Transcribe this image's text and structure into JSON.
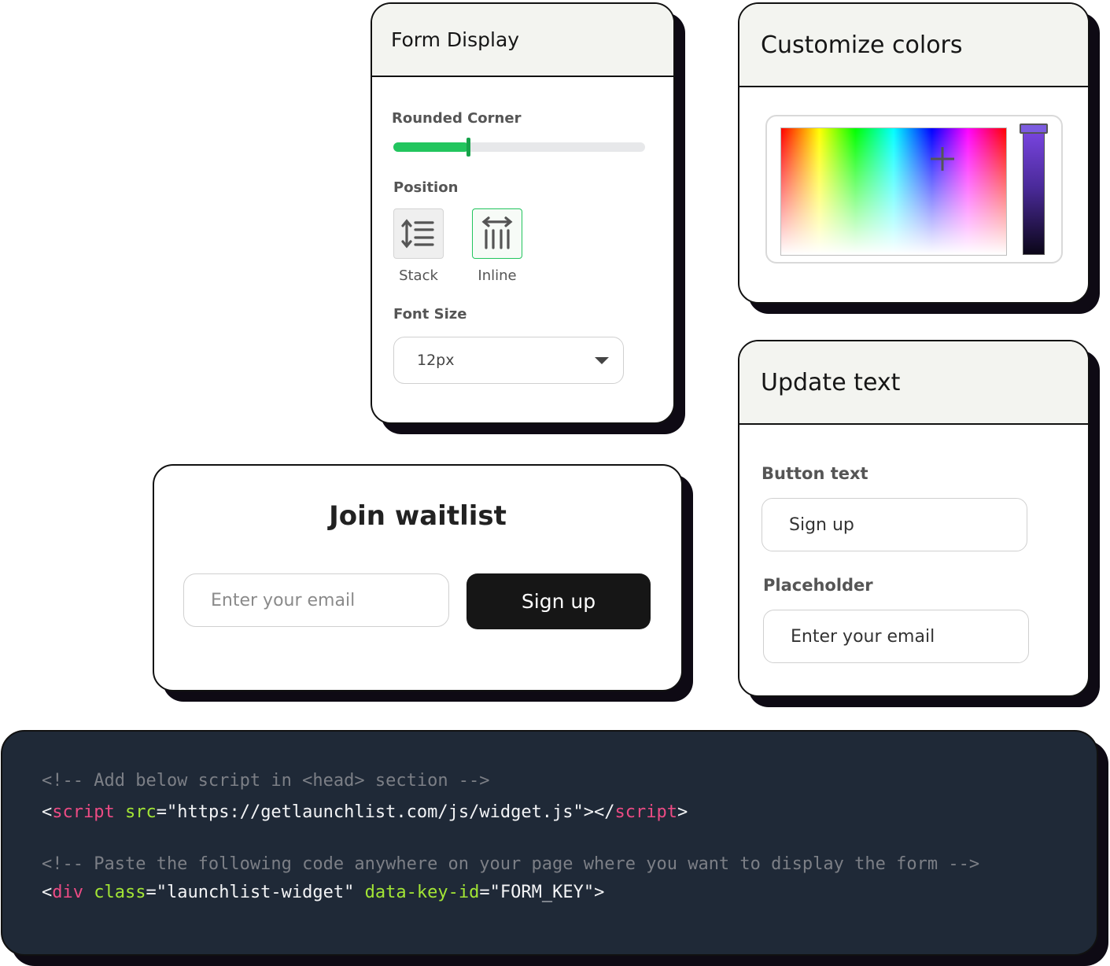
{
  "form_display": {
    "title": "Form Display",
    "rounded_corner_label": "Rounded Corner",
    "rounded_corner_value": 0.3,
    "position_label": "Position",
    "position_options": [
      {
        "label": "Stack",
        "icon": "stack-lines-icon",
        "selected": false
      },
      {
        "label": "Inline",
        "icon": "inline-columns-icon",
        "selected": true
      }
    ],
    "font_size_label": "Font Size",
    "font_size_value": "12px",
    "accent_color": "#22c55e"
  },
  "customize_colors": {
    "title": "Customize colors",
    "hue_selected": "#7c5ce0"
  },
  "update_text": {
    "title": "Update text",
    "button_text_label": "Button text",
    "button_text_value": "Sign up",
    "placeholder_label": "Placeholder",
    "placeholder_value": "Enter your email"
  },
  "waitlist": {
    "title": "Join waitlist",
    "email_placeholder": "Enter your email",
    "button_label": "Sign up"
  },
  "code": {
    "line1_comment": "<!-- Add below script in <head> section -->",
    "line2": {
      "open_lt": "<",
      "tag": "script",
      "attr": "src",
      "eq": "=",
      "value": "\"https://getlaunchlist.com/js/widget.js\"",
      "close": "></",
      "end_tag": "script",
      "end_gt": ">"
    },
    "line3_comment": "<!-- Paste the following code anywhere on your page where you want to display the form -->",
    "line4": {
      "open_lt": "<",
      "tag": "div",
      "attr1": "class",
      "eq1": "=",
      "value1": "\"launchlist-widget\"",
      "attr2": "data-key-id",
      "eq2": "=",
      "value2": "\"FORM_KEY\"",
      "end_gt": ">"
    }
  }
}
